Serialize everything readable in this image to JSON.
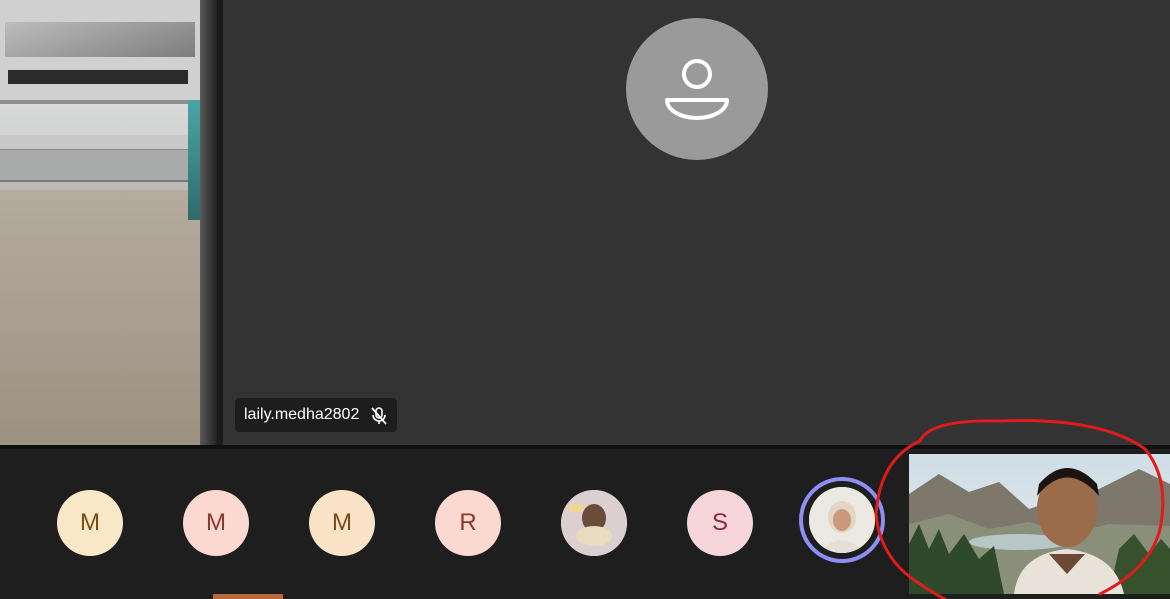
{
  "stage": {
    "main_tile": {
      "participant_name": "laily.medha2802",
      "mic_state_icon": "microphone-off-icon",
      "avatar_icon": "person-icon",
      "background_color": "#333333",
      "avatar_circle_color": "#9a9a9a"
    },
    "left_tile": {
      "content": "camera-video"
    }
  },
  "participant_strip": {
    "participants": [
      {
        "initial": "M",
        "bg": "#f8e8c8",
        "fg": "#7a4c16"
      },
      {
        "initial": "M",
        "bg": "#fbd9d1",
        "fg": "#8a3a2a"
      },
      {
        "initial": "M",
        "bg": "#fbe3c8",
        "fg": "#7a4c16"
      },
      {
        "initial": "R",
        "bg": "#fbd9d1",
        "fg": "#8a3a2a"
      },
      {
        "initial": "",
        "photo": true
      },
      {
        "initial": "S",
        "bg": "#f6d6d9",
        "fg": "#8a2a3a"
      },
      {
        "initial": "",
        "photo": true,
        "speaking": true
      }
    ],
    "speaking_ring_color": "#8e8ff5",
    "self_view": "camera-video",
    "annotation_color": "#e11b1b"
  }
}
